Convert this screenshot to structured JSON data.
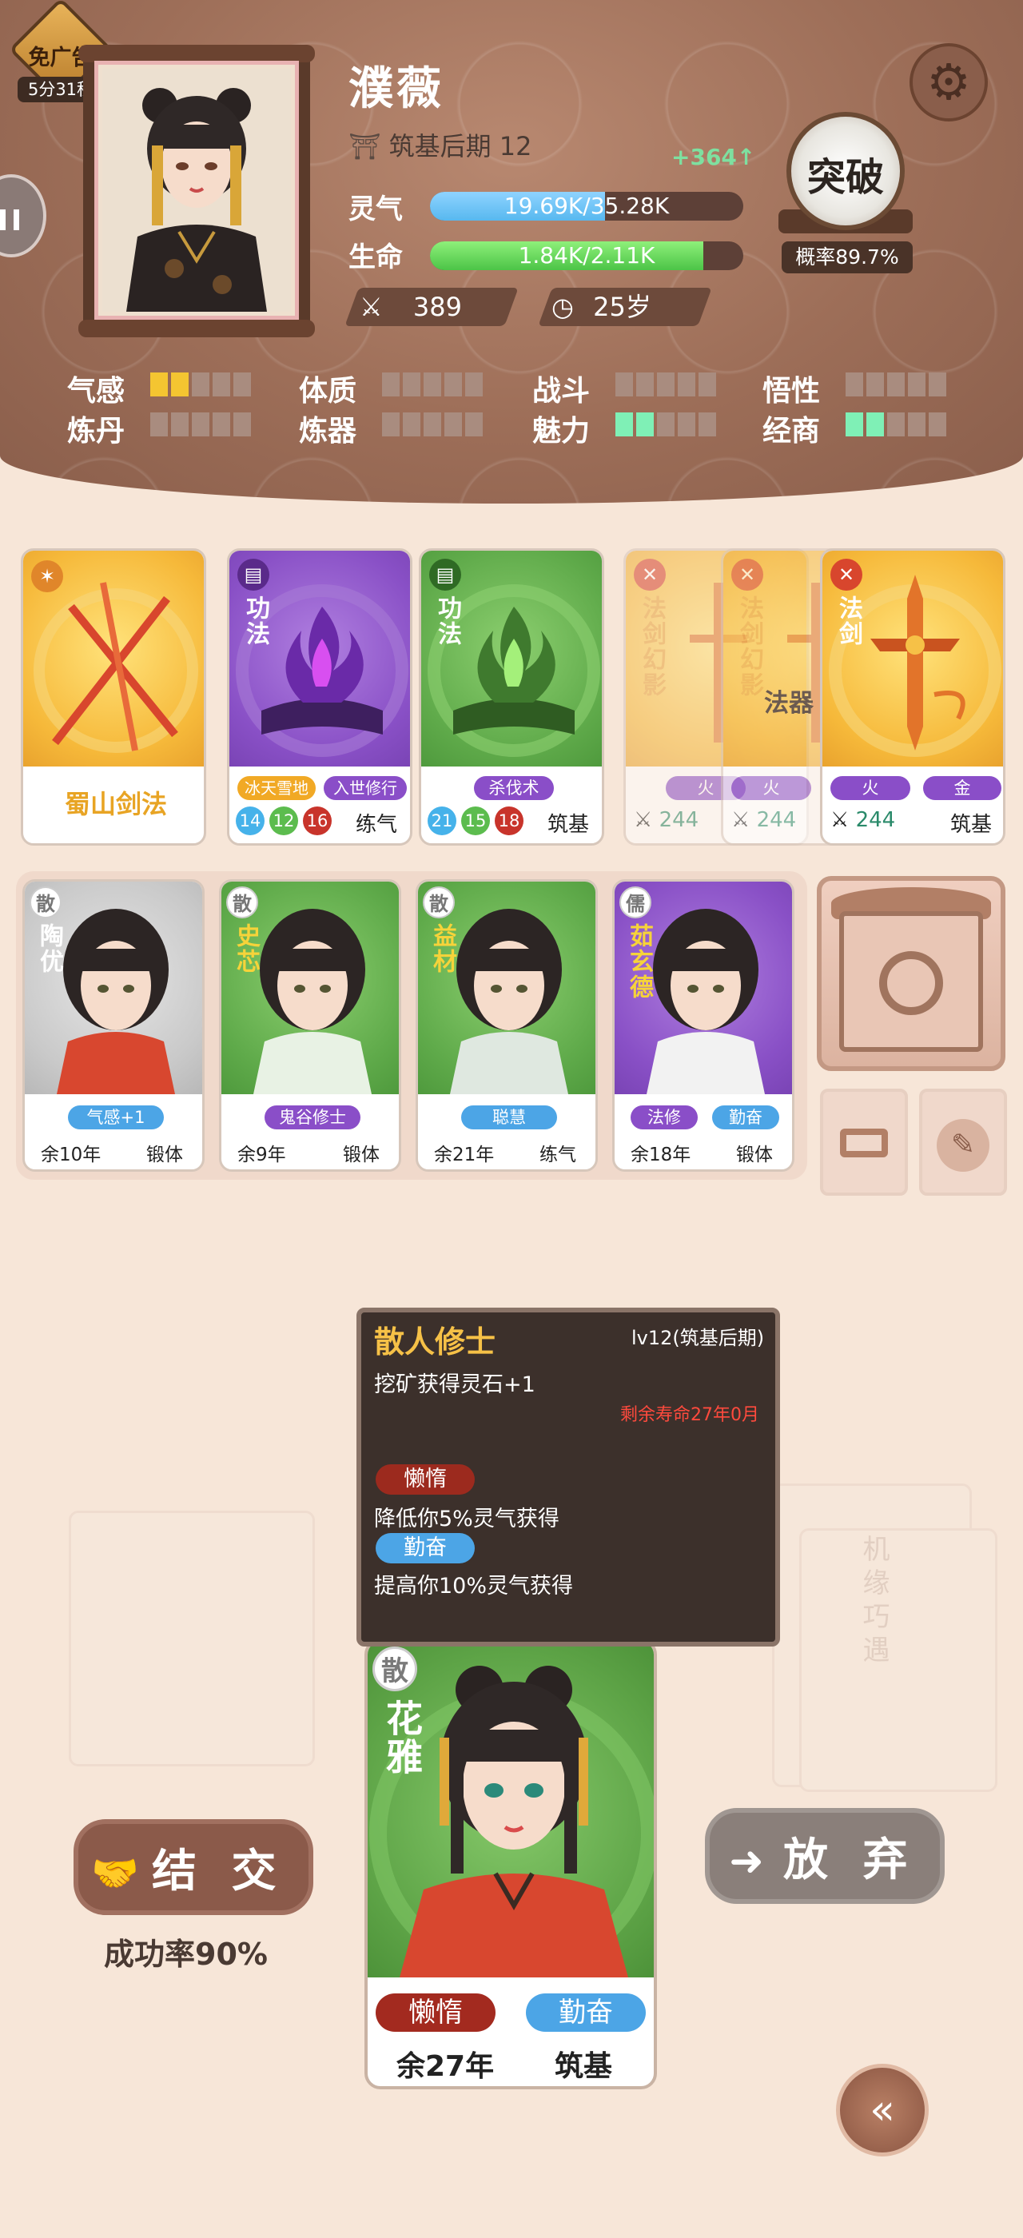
{
  "ad": {
    "label": "免广告",
    "timer": "5分31秒"
  },
  "player": {
    "name": "濮薇",
    "realm": "筑基后期 12",
    "gain": "+364↑",
    "spirit_label": "灵气",
    "spirit_text": "19.69K/35.28K",
    "spirit_ratio": 0.558,
    "life_label": "生命",
    "life_text": "1.84K/2.11K",
    "life_ratio": 0.872,
    "power": "389",
    "age": "25岁"
  },
  "breakthrough": {
    "label": "突破",
    "probability": "概率89.7%"
  },
  "attributes": [
    {
      "name": "气感",
      "level": 2,
      "color": "yellow"
    },
    {
      "name": "体质",
      "level": 0,
      "color": "yellow"
    },
    {
      "name": "战斗",
      "level": 0,
      "color": "yellow"
    },
    {
      "name": "悟性",
      "level": 0,
      "color": "yellow"
    },
    {
      "name": "炼丹",
      "level": 0,
      "color": "yellow"
    },
    {
      "name": "炼器",
      "level": 0,
      "color": "yellow"
    },
    {
      "name": "魅力",
      "level": 2,
      "color": "green"
    },
    {
      "name": "经商",
      "level": 2,
      "color": "green"
    }
  ],
  "skill_cards": [
    {
      "name": "蜀山剑法",
      "theme": "yellow"
    },
    {
      "type": "功法",
      "tags": [
        "冰天雪地",
        "入世修行"
      ],
      "nums": [
        "14",
        "12",
        "16"
      ],
      "stage": "练气",
      "theme": "purple"
    },
    {
      "type": "功法",
      "tags": [
        "杀伐术"
      ],
      "nums": [
        "21",
        "15",
        "18"
      ],
      "stage": "筑基",
      "theme": "green"
    }
  ],
  "weapon_cards": [
    {
      "type": "法剑幻影",
      "tag": "火",
      "power": "244"
    },
    {
      "type": "法剑幻影",
      "tag": "火",
      "power": "244"
    },
    {
      "type": "法剑",
      "tags": [
        "火",
        "金"
      ],
      "power": "244",
      "stage": "筑基"
    }
  ],
  "weapon_overlay": "法器",
  "companions": [
    {
      "badge": "散",
      "name": "陶优",
      "trait": "气感+1",
      "life": "余10年",
      "stage": "锻体",
      "theme": "grey"
    },
    {
      "badge": "散",
      "name": "史芯",
      "trait": "鬼谷修士",
      "life": "余9年",
      "stage": "锻体",
      "theme": "green"
    },
    {
      "badge": "散",
      "name": "益材",
      "trait": "聪慧",
      "life": "余21年",
      "stage": "练气",
      "theme": "green"
    },
    {
      "badge": "儒",
      "name": "茹玄德",
      "traits": [
        "法修",
        "勤奋"
      ],
      "life": "余18年",
      "stage": "锻体",
      "theme": "purple"
    }
  ],
  "tooltip": {
    "title": "散人修士",
    "level": "lv12(筑基后期)",
    "effect": "挖矿获得灵石+1",
    "lifespan": "剩余寿命27年0月",
    "trait1": "懒惰",
    "trait1_desc": "降低你5%灵气获得",
    "trait2": "勤奋",
    "trait2_desc": "提高你10%灵气获得"
  },
  "bg_card_text": "机缘巧遇",
  "encounter": {
    "badge": "散",
    "name": "花雅",
    "trait1": "懒惰",
    "trait2": "勤奋",
    "life": "余27年",
    "stage": "筑基"
  },
  "actions": {
    "befriend": "结 交",
    "success_rate": "成功率90%",
    "abandon": "放 弃"
  },
  "colors": {
    "header": "#9d6e58",
    "background": "#f7e6d8",
    "spirit_bar": "#57b8ef",
    "life_bar": "#4cc447",
    "accent_gold": "#f6c147"
  }
}
